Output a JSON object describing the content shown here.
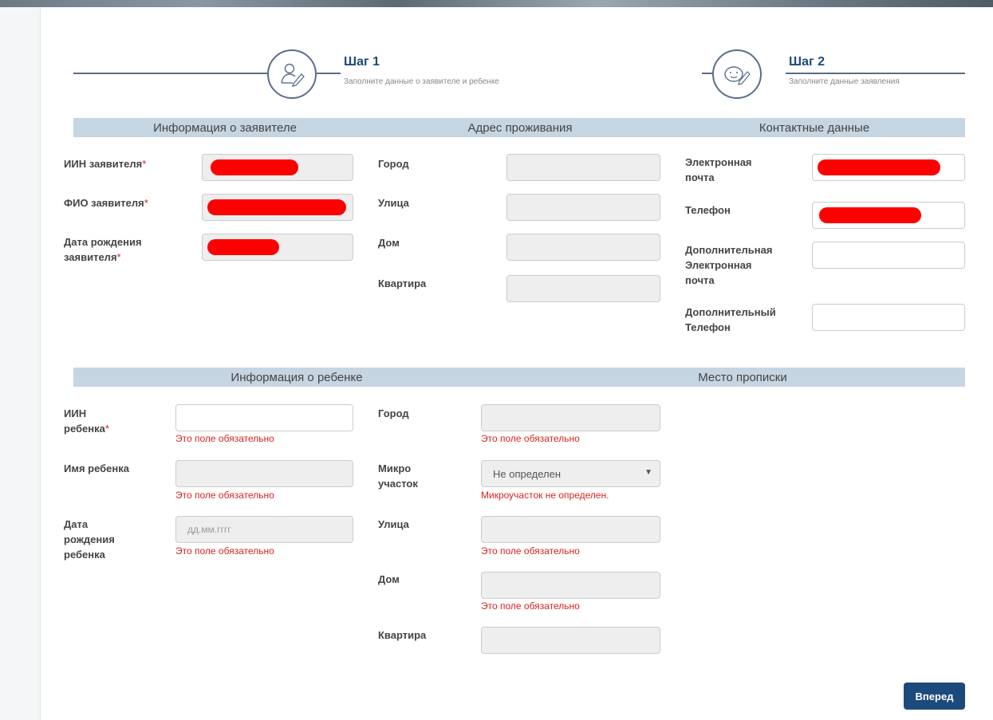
{
  "steps": [
    {
      "title": "Шаг 1",
      "subtitle": "Заполните данные о заявителе и ребенке",
      "icon": "user-signature-icon"
    },
    {
      "title": "Шаг 2",
      "subtitle": "Заполните данные заявления",
      "icon": "baby-face-icon"
    }
  ],
  "sections": {
    "applicant": "Информация о заявителе",
    "address": "Адрес проживания",
    "contacts": "Контактные данные",
    "child": "Информация о ребенке",
    "registration": "Место прописки"
  },
  "applicant": {
    "iin_label": "ИИН заявителя",
    "fio_label": "ФИО заявителя",
    "dob_label_1": "Дата рождения",
    "dob_label_2": "заявителя",
    "required_mark": "*"
  },
  "address": {
    "city": "Город",
    "street": "Улица",
    "house": "Дом",
    "apartment": "Квартира"
  },
  "contacts": {
    "email_1": "Электронная",
    "email_2": "почта",
    "phone": "Телефон",
    "extra_email_1": "Дополнительная",
    "extra_email_2": "Электронная",
    "extra_email_3": "почта",
    "extra_phone_1": "Дополнительный",
    "extra_phone_2": "Телефон"
  },
  "child": {
    "iin_label_1": "ИИН",
    "iin_label_2": "ребенка",
    "name_label": "Имя ребенка",
    "dob_label_1": "Дата",
    "dob_label_2": "рождения",
    "dob_label_3": "ребенка",
    "dob_placeholder": "дд.мм.гггг",
    "required_mark": "*"
  },
  "registration": {
    "city": "Город",
    "micro_1": "Микро",
    "micro_2": "участок",
    "micro_value": "Не определен",
    "micro_error": "Микроучасток не определен.",
    "street": "Улица",
    "house": "Дом",
    "apartment": "Квартира"
  },
  "errors": {
    "required": "Это поле обязательно"
  },
  "buttons": {
    "next": "Вперед"
  },
  "colors": {
    "accent": "#1d4a7c",
    "section_bar": "#c6d5e2",
    "error": "#d9231f",
    "redaction": "#ff0000"
  }
}
